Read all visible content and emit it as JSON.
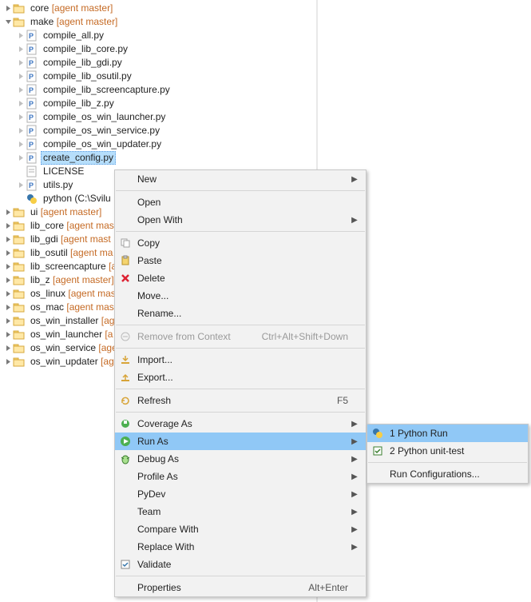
{
  "tree": {
    "core": {
      "name": "core",
      "branch": "[agent master]"
    },
    "make": {
      "name": "make",
      "branch": "[agent master]",
      "children": {
        "compile_all": "compile_all.py",
        "compile_lib_core": "compile_lib_core.py",
        "compile_lib_gdi": "compile_lib_gdi.py",
        "compile_lib_osutil": "compile_lib_osutil.py",
        "compile_lib_screencap": "compile_lib_screencapture.py",
        "compile_lib_z": "compile_lib_z.py",
        "compile_os_win_launcher": "compile_os_win_launcher.py",
        "compile_os_win_service": "compile_os_win_service.py",
        "compile_os_win_updater": "compile_os_win_updater.py",
        "create_config": "create_config.py",
        "license": "LICENSE",
        "utils": "utils.py",
        "python_exe": "python  (C:\\Svilu"
      }
    },
    "ui": {
      "name": "ui",
      "branch": "[agent master]"
    },
    "lib_core": {
      "name": "lib_core",
      "branch": "[agent mas"
    },
    "lib_gdi": {
      "name": "lib_gdi",
      "branch": "[agent mast"
    },
    "lib_osutil": {
      "name": "lib_osutil",
      "branch": "[agent ma"
    },
    "lib_screencapture": {
      "name": "lib_screencapture",
      "branch": "[a"
    },
    "lib_z": {
      "name": "lib_z",
      "branch": "[agent master]"
    },
    "os_linux": {
      "name": "os_linux",
      "branch": "[agent mas"
    },
    "os_mac": {
      "name": "os_mac",
      "branch": "[agent mas"
    },
    "os_win_installer": {
      "name": "os_win_installer",
      "branch": "[ag"
    },
    "os_win_launcher": {
      "name": "os_win_launcher",
      "branch": "[a"
    },
    "os_win_service": {
      "name": "os_win_service",
      "branch": "[age"
    },
    "os_win_updater": {
      "name": "os_win_updater",
      "branch": "[ag"
    }
  },
  "menu": {
    "new": "New",
    "open": "Open",
    "open_with": "Open With",
    "copy": "Copy",
    "paste": "Paste",
    "delete": "Delete",
    "move": "Move...",
    "rename": "Rename...",
    "remove_ctx": "Remove from Context",
    "remove_ctx_sc": "Ctrl+Alt+Shift+Down",
    "import": "Import...",
    "export": "Export...",
    "refresh": "Refresh",
    "refresh_sc": "F5",
    "coverage_as": "Coverage As",
    "run_as": "Run As",
    "debug_as": "Debug As",
    "profile_as": "Profile As",
    "pydev": "PyDev",
    "team": "Team",
    "compare_with": "Compare With",
    "replace_with": "Replace With",
    "validate": "Validate",
    "properties": "Properties",
    "properties_sc": "Alt+Enter"
  },
  "submenu": {
    "python_run": "1 Python Run",
    "python_unit": "2 Python unit-test",
    "run_config": "Run Configurations..."
  }
}
